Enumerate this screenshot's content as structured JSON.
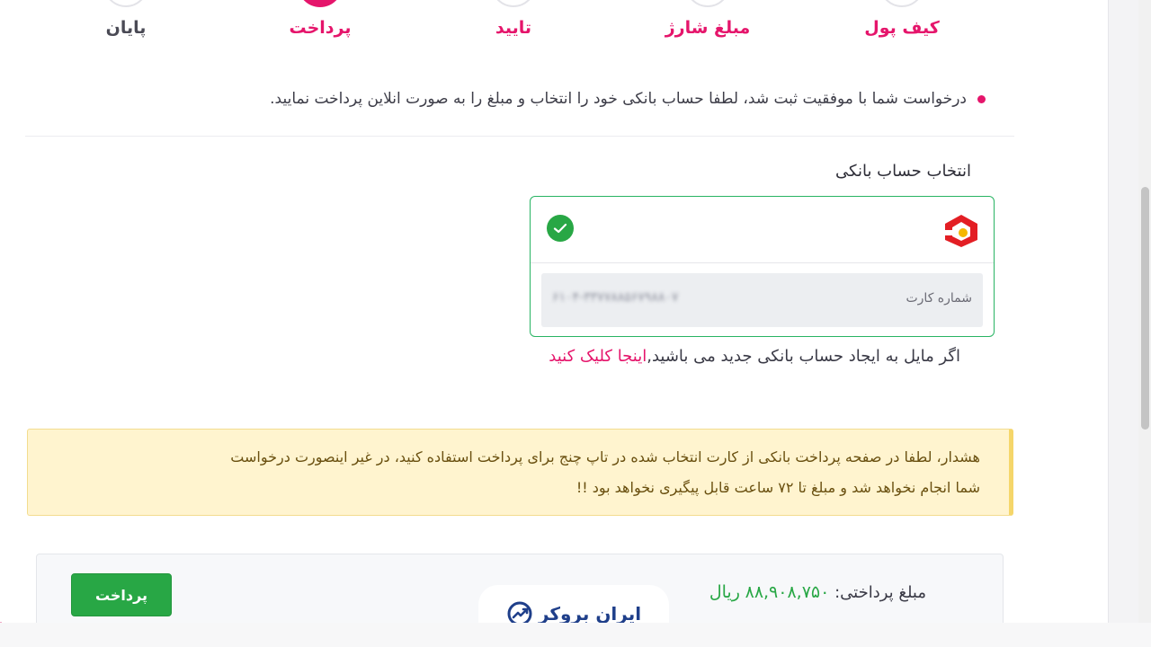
{
  "steps": [
    {
      "label": "پایان"
    },
    {
      "label": "پرداخت"
    },
    {
      "label": "تایید"
    },
    {
      "label": "مبلغ شارژ"
    },
    {
      "label": "کیف پول"
    }
  ],
  "notice": "درخواست شما با موفقیت ثبت شد، لطفا حساب بانکی خود را انتخاب و مبلغ را به صورت انلاین پرداخت نمایید.",
  "bank_section": {
    "title": "انتخاب حساب بانکی",
    "card_label": "شماره کارت",
    "card_number_blurred": "۶۱۰۴-۳۳۷۷۸۸۵۶۷۹۸۸۰۷"
  },
  "new_account": {
    "text": "اگر مایل به ایجاد حساب بانکی جدید می باشید,",
    "link": "اینجا کلیک کنید"
  },
  "warning": {
    "line1": "هشدار، لطفا در صفحه پرداخت بانکی از کارت انتخاب شده در تاپ چنج برای پرداخت استفاده کنید، در غیر اینصورت درخواست",
    "line2": "شما انجام نخواهد شد و مبلغ تا ۷۲ ساعت قابل پیگیری نخواهد بود !!"
  },
  "payment": {
    "label": "مبلغ پرداختی:",
    "amount": "۸۸,۹۰۸,۷۵۰",
    "currency": "ریال",
    "button": "پرداخت"
  },
  "watermark": "ایران بروکر",
  "colors": {
    "accent": "#e5156b",
    "success": "#28a745",
    "warning_bg": "#fff4cf",
    "bank_logo": "#e31e24"
  }
}
